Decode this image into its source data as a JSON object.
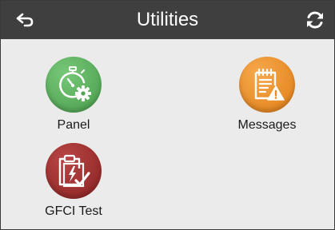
{
  "header": {
    "title": "Utilities",
    "back_icon": "back-arrow-icon",
    "refresh_icon": "refresh-icon"
  },
  "tiles": [
    {
      "label": "Panel",
      "icon": "stopwatch-gear-icon",
      "color": "#57b05a"
    },
    {
      "label": "Messages",
      "icon": "notepad-warning-icon",
      "color": "#ee8c23"
    },
    {
      "label": "GFCI Test",
      "icon": "clipboard-check-icon",
      "color": "#9c2a2a"
    }
  ],
  "colors": {
    "header_bg": "#3f3f3f",
    "body_bg": "#ebebeb",
    "title_text": "#ffffff"
  }
}
